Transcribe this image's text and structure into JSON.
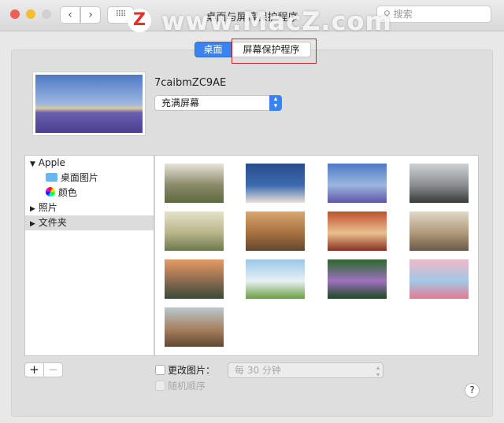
{
  "window": {
    "title": "桌面与屏幕保护程序",
    "search_placeholder": "搜索",
    "watermark": "www.MacZ.com",
    "watermark_logo": "Z"
  },
  "tabs": [
    {
      "label": "桌面",
      "selected": true
    },
    {
      "label": "屏幕保护程序",
      "selected": false
    }
  ],
  "current": {
    "name": "7caibmZC9AE",
    "fit_option": "充满屏幕"
  },
  "sidebar": {
    "items": [
      {
        "label": "Apple",
        "expanded": true,
        "level": 0
      },
      {
        "label": "桌面图片",
        "level": 1,
        "icon": "folder-icon"
      },
      {
        "label": "颜色",
        "level": 1,
        "icon": "color-wheel-icon"
      },
      {
        "label": "照片",
        "expanded": false,
        "level": 0
      },
      {
        "label": "文件夹",
        "expanded": false,
        "level": 0,
        "selected": true
      }
    ]
  },
  "thumbnails": [
    {
      "name": "flowers-room",
      "colors": [
        "#e8e4d8",
        "#8a8a6a",
        "#5f6a3f"
      ]
    },
    {
      "name": "dogs-blue",
      "colors": [
        "#2a4d8c",
        "#3b6ab0",
        "#e8e0d8"
      ]
    },
    {
      "name": "lavender-field",
      "colors": [
        "#4f79c4",
        "#9bb6df",
        "#5f55a8"
      ]
    },
    {
      "name": "snowy-church",
      "colors": [
        "#cfd2d4",
        "#8a8e90",
        "#3a3a3a"
      ]
    },
    {
      "name": "tower-field",
      "colors": [
        "#e6e2c8",
        "#b8b48a",
        "#6b7a4a"
      ]
    },
    {
      "name": "camera-girl",
      "colors": [
        "#d8a870",
        "#a87040",
        "#604830"
      ]
    },
    {
      "name": "toy-moose",
      "colors": [
        "#c05030",
        "#e8c090",
        "#8a3020"
      ]
    },
    {
      "name": "child-window",
      "colors": [
        "#e0d8c8",
        "#b0987a",
        "#6a5a48"
      ]
    },
    {
      "name": "sunset-hills",
      "colors": [
        "#e89a60",
        "#8a6a50",
        "#3a4a38"
      ]
    },
    {
      "name": "wind-turbines",
      "colors": [
        "#9ac8e8",
        "#e8f0f4",
        "#6aa040"
      ]
    },
    {
      "name": "lotus",
      "colors": [
        "#2a6a2a",
        "#a070c0",
        "#1a4a20"
      ]
    },
    {
      "name": "pink-abstract",
      "colors": [
        "#f0b8c8",
        "#a0c8e8",
        "#e87890"
      ]
    },
    {
      "name": "street-buildings",
      "colors": [
        "#b8c8d0",
        "#a88060",
        "#604830"
      ]
    }
  ],
  "bottom": {
    "add": "+",
    "remove": "−",
    "change_picture_label": "更改图片：",
    "change_picture_checked": false,
    "interval": "每 30 分钟",
    "random_order_label": "随机顺序",
    "random_order_checked": false,
    "help": "?"
  },
  "colors": {
    "accent": "#3a83f0",
    "highlight": "#c62828"
  }
}
